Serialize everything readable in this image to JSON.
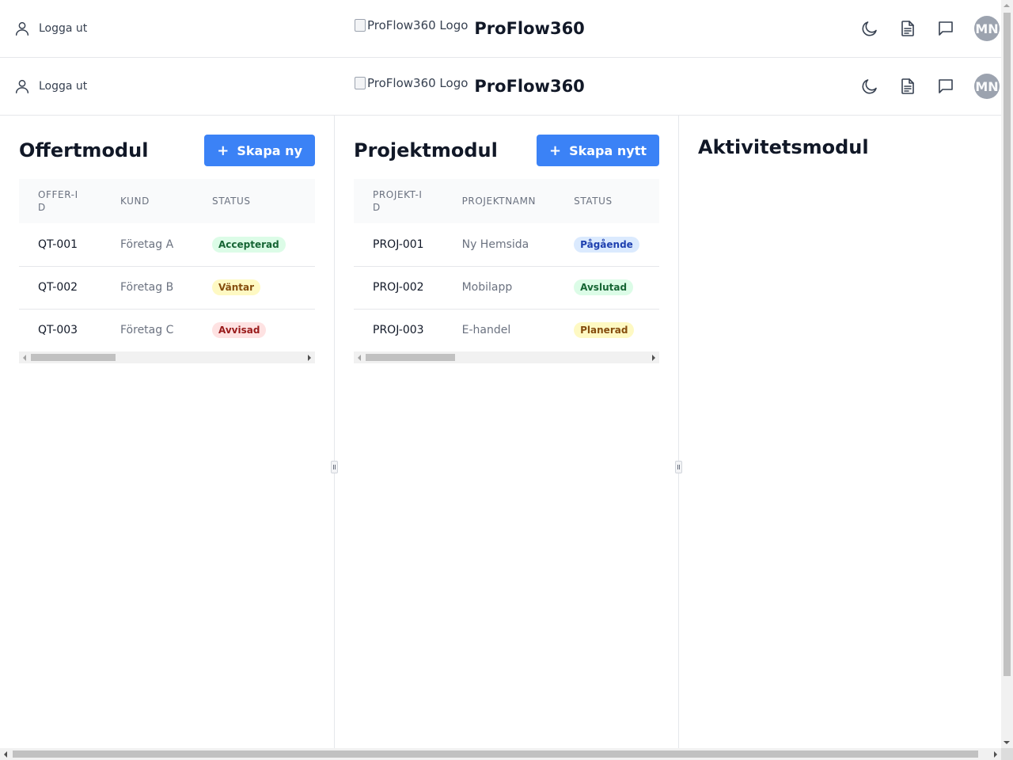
{
  "header": {
    "logout_label": "Logga ut",
    "logo_alt": "ProFlow360 Logo",
    "brand_name": "ProFlow360",
    "avatar_initials": "MN",
    "icons": [
      "user-icon",
      "moon-icon",
      "document-icon",
      "chat-icon"
    ]
  },
  "offert": {
    "title": "Offertmodul",
    "create_label": "Skapa ny",
    "columns": [
      "OFFER-ID",
      "KUND",
      "STATUS"
    ],
    "rows": [
      {
        "id": "QT-001",
        "customer": "Företag A",
        "status": "Accepterad",
        "status_color": "#dcfce7"
      },
      {
        "id": "QT-002",
        "customer": "Företag B",
        "status": "Väntar",
        "status_color": "#fef9c3"
      },
      {
        "id": "QT-003",
        "customer": "Företag C",
        "status": "Avvisad",
        "status_color": "#fee2e2"
      }
    ]
  },
  "projekt": {
    "title": "Projektmodul",
    "create_label": "Skapa nytt",
    "columns": [
      "PROJEKT-ID",
      "PROJEKTNAMN",
      "STATUS"
    ],
    "rows": [
      {
        "id": "PROJ-001",
        "name": "Ny Hemsida",
        "status": "Pågående",
        "status_color": "#dbeafe"
      },
      {
        "id": "PROJ-002",
        "name": "Mobilapp",
        "status": "Avslutad",
        "status_color": "#dcfce7"
      },
      {
        "id": "PROJ-003",
        "name": "E-handel",
        "status": "Planerad",
        "status_color": "#fef9c3"
      }
    ]
  },
  "aktivitet": {
    "title": "Aktivitetsmodul"
  },
  "colors": {
    "accent": "#3b82f6",
    "border": "#e5e7eb",
    "text": "#111827",
    "muted": "#6b7280"
  }
}
